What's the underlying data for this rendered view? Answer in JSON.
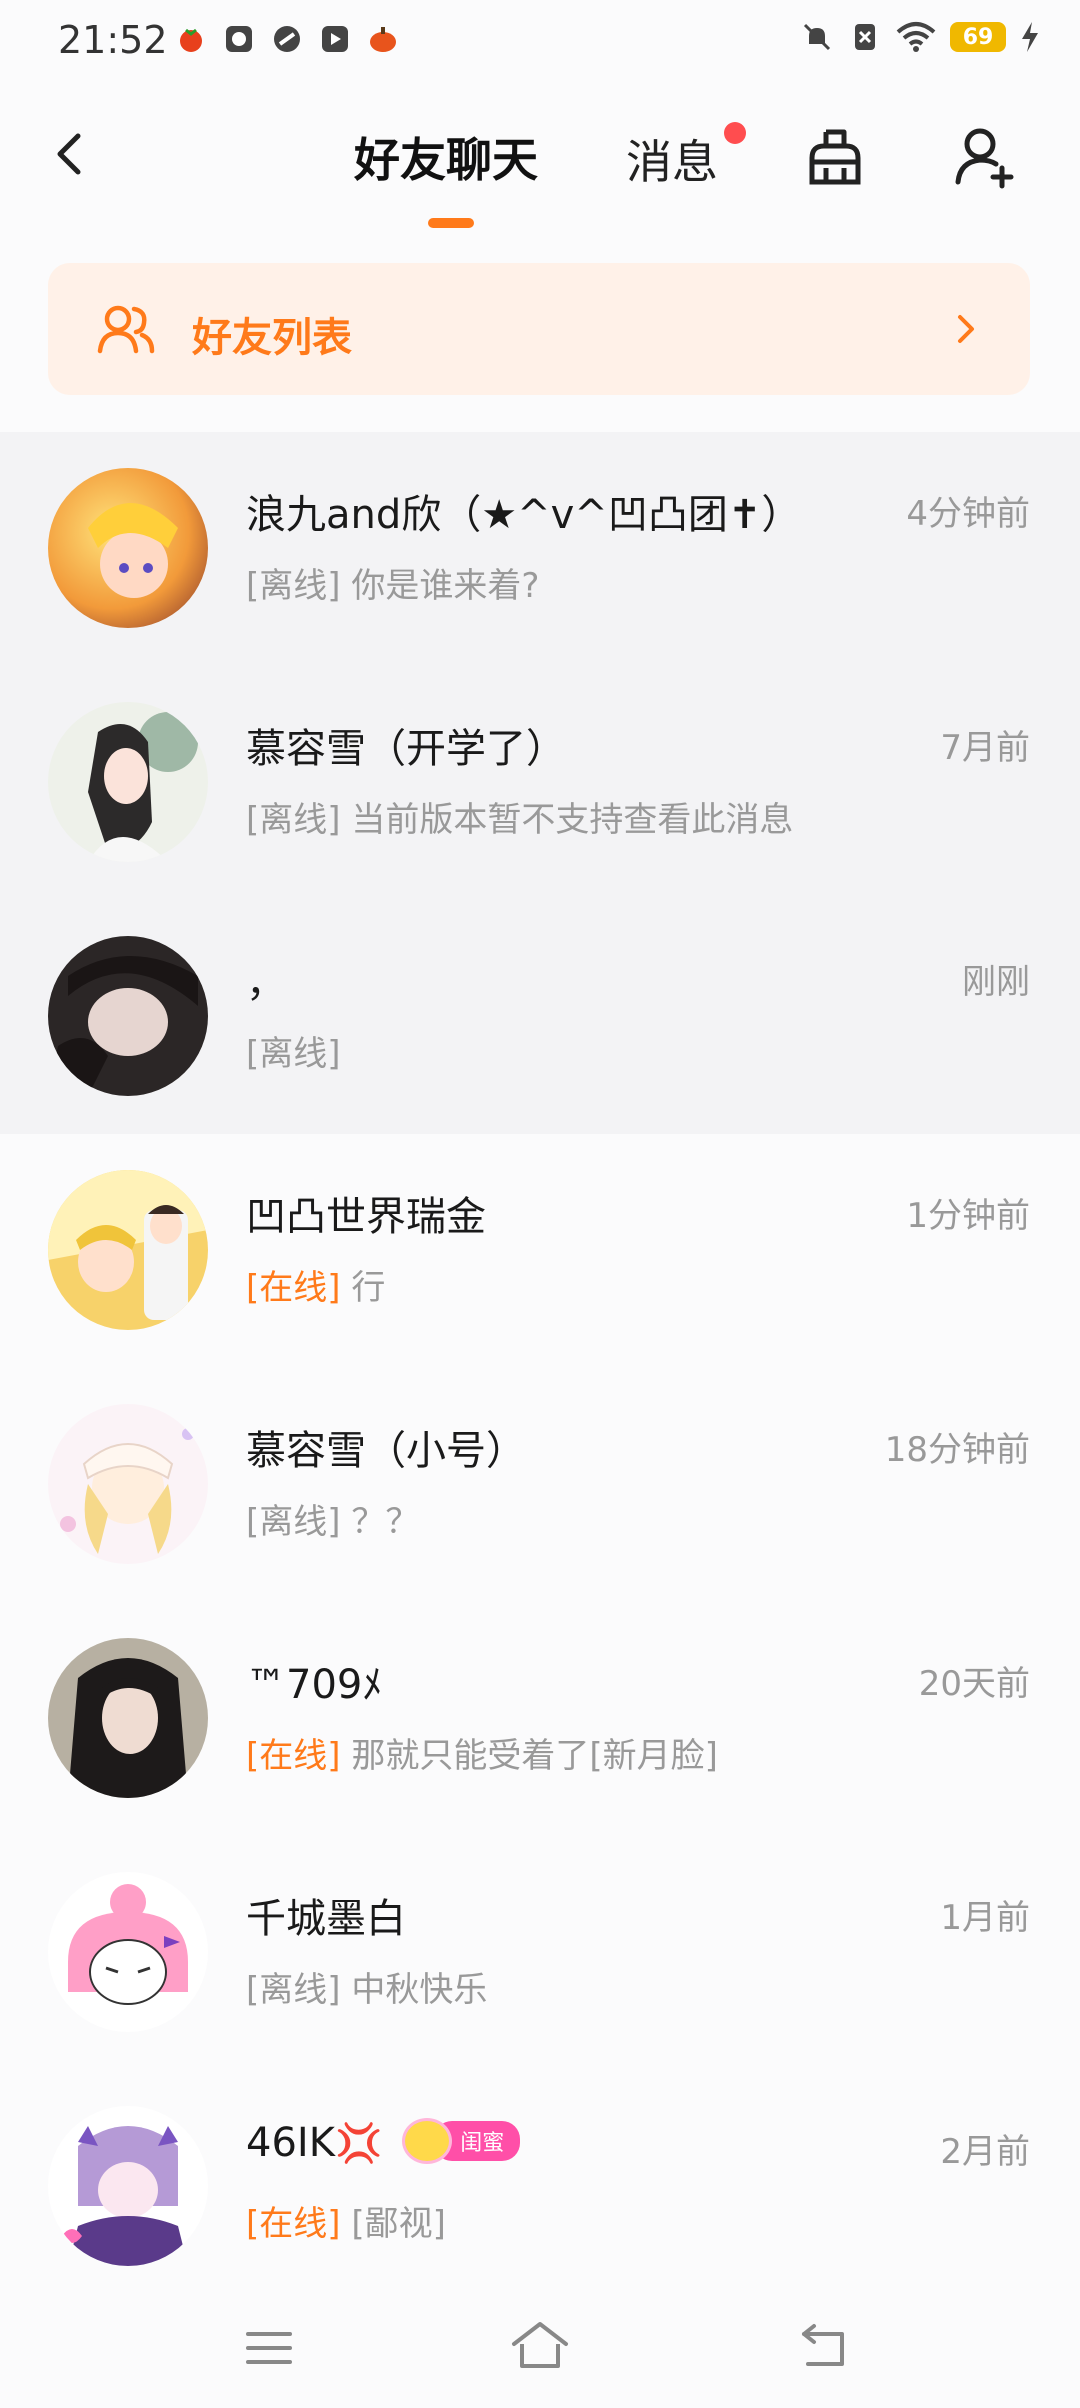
{
  "status_bar": {
    "time": "21:52",
    "battery": "69",
    "icons_left": [
      "tomato-app-icon",
      "shield-app-icon",
      "link-app-icon",
      "video-app-icon",
      "pumpkin-app-icon"
    ],
    "icons_right": [
      "mute-icon",
      "sim-off-icon",
      "wifi-icon",
      "battery-icon",
      "charging-icon"
    ]
  },
  "header": {
    "active_tab": "好友聊天",
    "messages_tab": "消息",
    "accent_color": "#ff7a1a",
    "dot_color": "#ff4d4f"
  },
  "friend_list_banner": {
    "label": "好友列表"
  },
  "chats": [
    {
      "name": "浪九and欣（★^v^凹凸团✝）",
      "time": "4分钟前",
      "status": "[离线]",
      "preview": " 你是谁来着?",
      "online": false,
      "pinned": true
    },
    {
      "name": "慕容雪（开学了）",
      "time": "7月前",
      "status": "[离线]",
      "preview": " 当前版本暂不支持查看此消息",
      "online": false,
      "pinned": true
    },
    {
      "name": "，",
      "time": "刚刚",
      "status": "[离线]",
      "preview": "",
      "online": false,
      "pinned": true
    },
    {
      "name": "凹凸世界瑞金",
      "time": "1分钟前",
      "status": "[在线]",
      "preview": " 行",
      "online": true,
      "pinned": false
    },
    {
      "name": "慕容雪（小号）",
      "time": "18分钟前",
      "status": "[离线]",
      "preview": " ？？",
      "online": false,
      "pinned": false
    },
    {
      "name": "™709ﾒ",
      "time": "20天前",
      "status": "[在线]",
      "preview": " 那就只能受着了[新月脸]",
      "online": true,
      "pinned": false
    },
    {
      "name": "千城墨白",
      "time": "1月前",
      "status": "[离线]",
      "preview": " 中秋快乐",
      "online": false,
      "pinned": false
    },
    {
      "name": "46IK",
      "time": "2月前",
      "status": "[在线]",
      "preview": " [鄙视]",
      "online": true,
      "pinned": false,
      "badge": "闺蜜"
    }
  ]
}
